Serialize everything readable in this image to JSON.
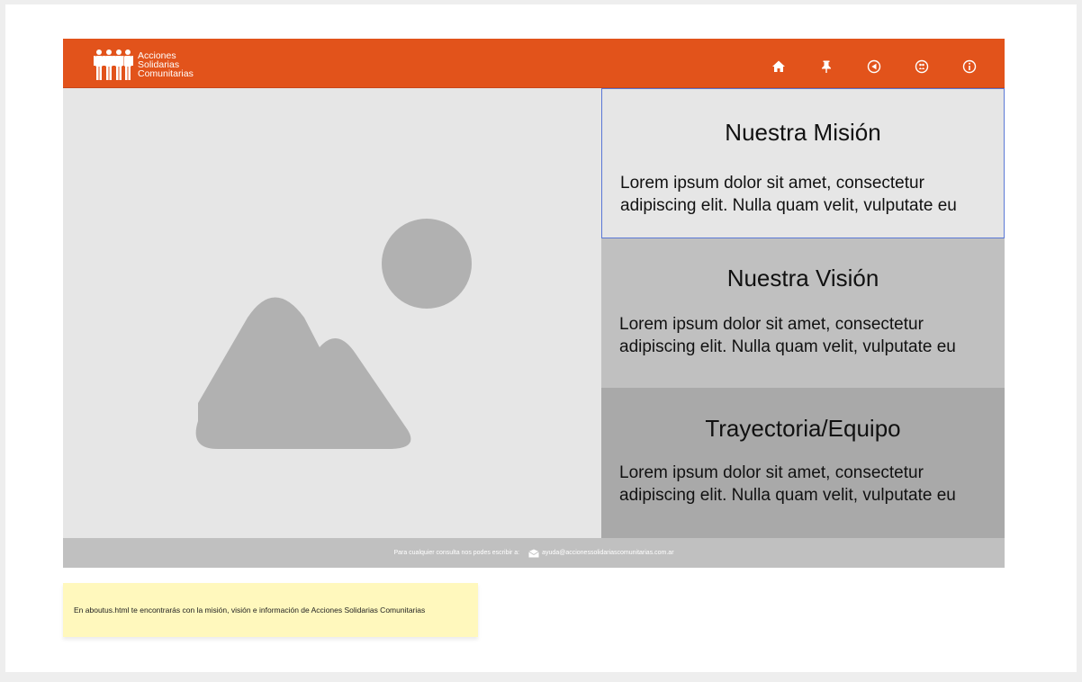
{
  "brand": {
    "line1": "Acciones",
    "line2": "Solidarias",
    "line3": "Comunitarias",
    "color": "#e2531b"
  },
  "nav": {
    "icons": [
      "home-icon",
      "pin-icon",
      "back-icon",
      "community-icon",
      "info-icon"
    ]
  },
  "sections": [
    {
      "title": "Nuestra Misión",
      "body": "Lorem ipsum dolor sit amet, consectetur adipiscing elit. Nulla quam velit, vulputate eu"
    },
    {
      "title": "Nuestra Visión",
      "body": "Lorem ipsum dolor sit amet, consectetur adipiscing elit. Nulla quam velit, vulputate eu"
    },
    {
      "title": "Trayectoria/Equipo",
      "body": "Lorem ipsum dolor sit amet, consectetur adipiscing elit. Nulla quam velit, vulputate eu"
    }
  ],
  "footer": {
    "contact_text": "Para cualquier consulta nos podes escribir a:",
    "email": "ayuda@accionessolidariascomunitarias.com.ar"
  },
  "note": {
    "text": "En aboutus.html te encontrarás con la misión, visión e información de Acciones Solidarias Comunitarias"
  }
}
